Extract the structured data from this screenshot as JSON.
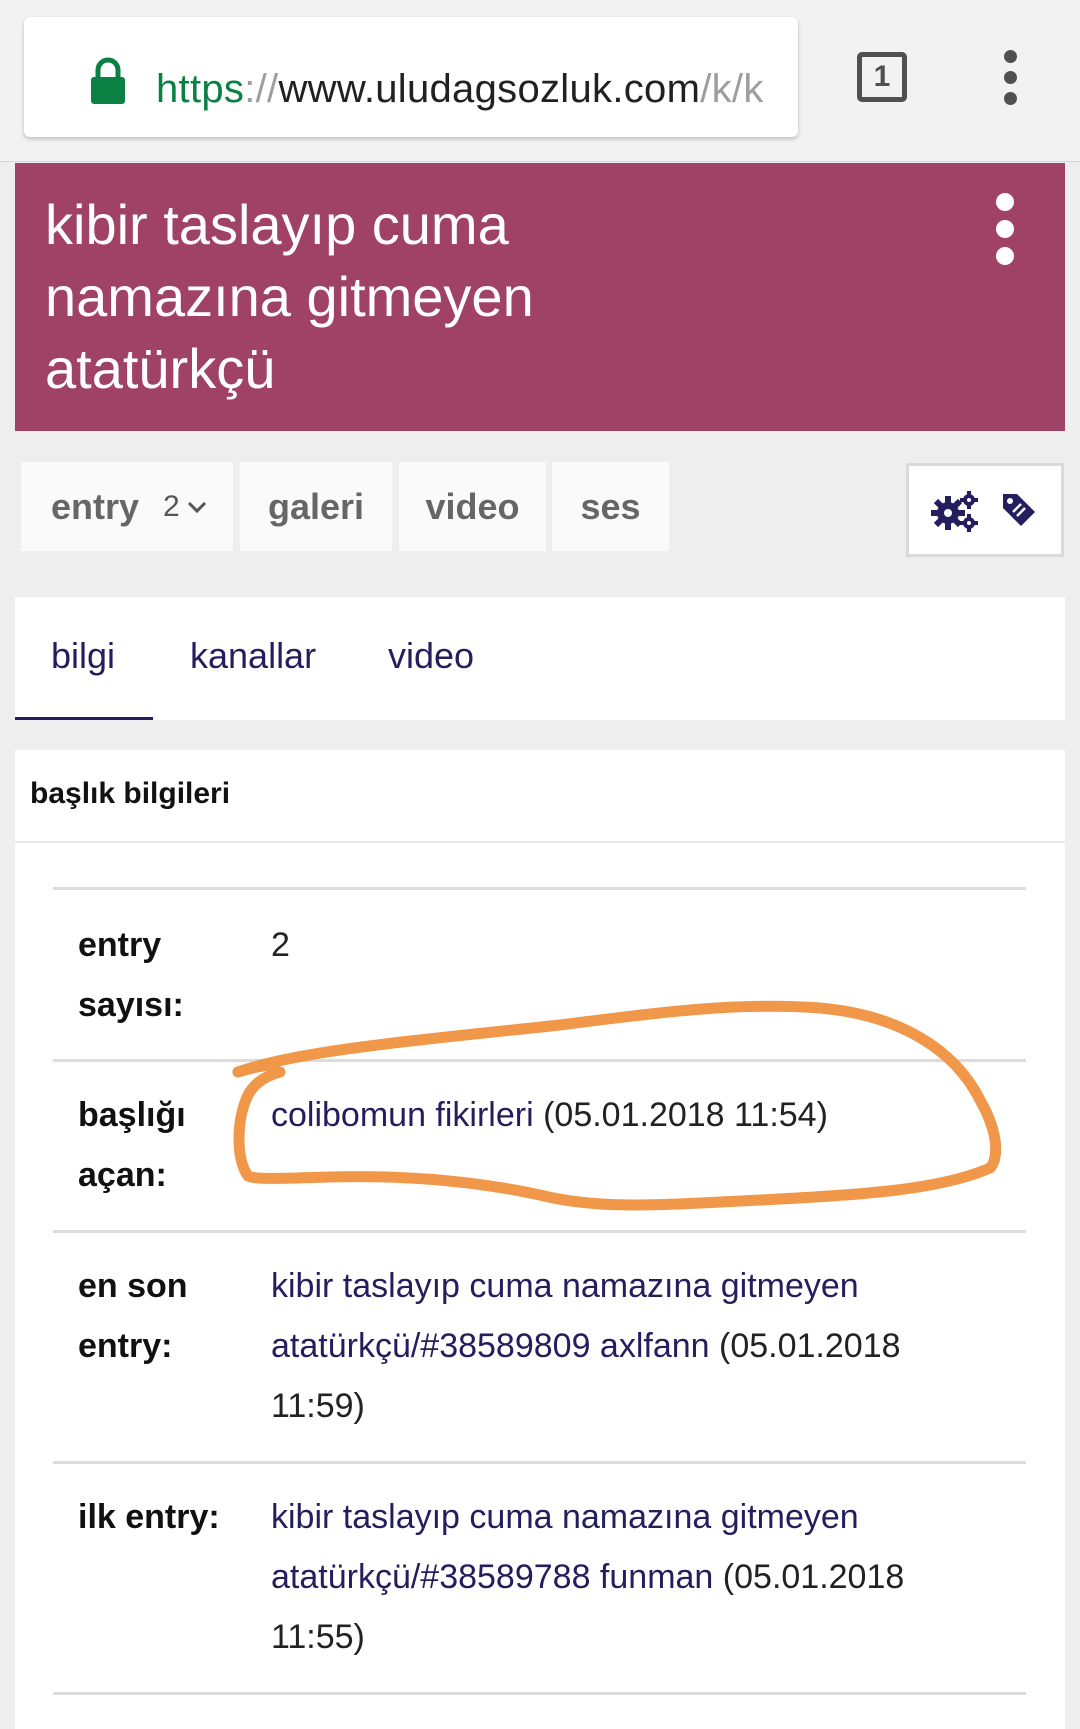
{
  "browser": {
    "url_scheme": "https",
    "url_sep": "://",
    "url_host": "www.uludagsozluk.com",
    "url_path": "/k/k",
    "tab_count": "1",
    "icons": [
      "lock-icon",
      "tabs-icon",
      "overflow-menu-icon"
    ]
  },
  "header": {
    "title": "kibir taslayıp cuma namazına gitmeyen atatürkçü",
    "background": "#a04265"
  },
  "tabs": {
    "entry_label": "entry",
    "entry_count": "2",
    "galeri_label": "galeri",
    "video_label": "video",
    "ses_label": "ses"
  },
  "subtabs": {
    "items": [
      "bilgi",
      "kanallar",
      "video"
    ],
    "active": "bilgi"
  },
  "info": {
    "title": "başlık bilgileri",
    "rows": [
      {
        "label": "entry sayısı:",
        "value": "2"
      },
      {
        "label": "başlığı açan:",
        "link": "colibomun fikirleri",
        "meta": "(05.01.2018 11:54)"
      },
      {
        "label": "en son entry:",
        "link": "kibir taslayıp cuma namazına gitmeyen atatürkçü/#38589809 axlfann",
        "meta": "(05.01.2018 11:59)"
      },
      {
        "label": "ilk entry:",
        "link": "kibir taslayıp cuma namazına gitmeyen atatürkçü/#38589788 funman",
        "meta": "(05.01.2018 11:55)"
      }
    ]
  },
  "colors": {
    "accent": "#a04265",
    "link": "#241e5e",
    "annotation": "#f0974a",
    "url_scheme": "#0b8043"
  }
}
